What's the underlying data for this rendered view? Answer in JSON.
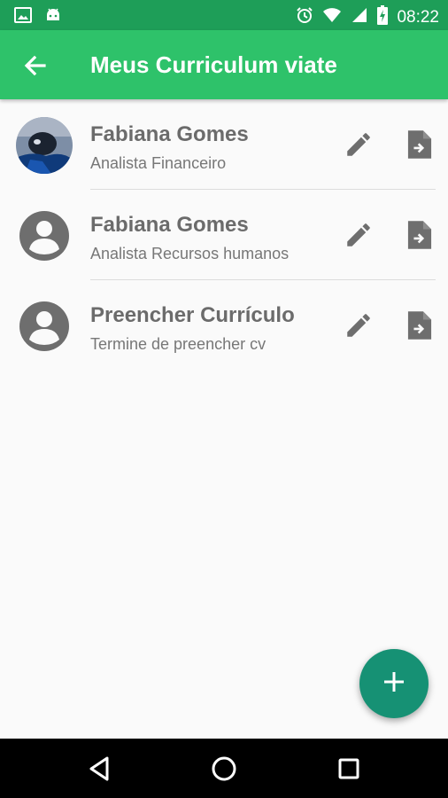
{
  "status_bar": {
    "time": "08:22",
    "icons": [
      "image-icon",
      "android-icon",
      "alarm-icon",
      "wifi-icon",
      "signal-icon",
      "battery-icon"
    ]
  },
  "app_bar": {
    "title": "Meus Curriculum viate",
    "back_icon": "arrow-back-icon",
    "background_color": "#2ec26a"
  },
  "list": {
    "items": [
      {
        "name": "Fabiana Gomes",
        "subtitle": "Analista Financeiro",
        "avatar": "photo",
        "actions": [
          "edit-icon",
          "export-file-icon"
        ]
      },
      {
        "name": "Fabiana Gomes",
        "subtitle": "Analista Recursos humanos",
        "avatar": "account-circle-icon",
        "actions": [
          "edit-icon",
          "export-file-icon"
        ]
      },
      {
        "name": "Preencher Currículo",
        "subtitle": "Termine de preencher cv",
        "avatar": "account-circle-icon",
        "actions": [
          "edit-icon",
          "export-file-icon"
        ]
      }
    ]
  },
  "fab": {
    "icon": "plus-icon",
    "color": "#169174"
  },
  "nav_bar": {
    "buttons": [
      "back-triangle-icon",
      "home-circle-icon",
      "recents-square-icon"
    ]
  }
}
